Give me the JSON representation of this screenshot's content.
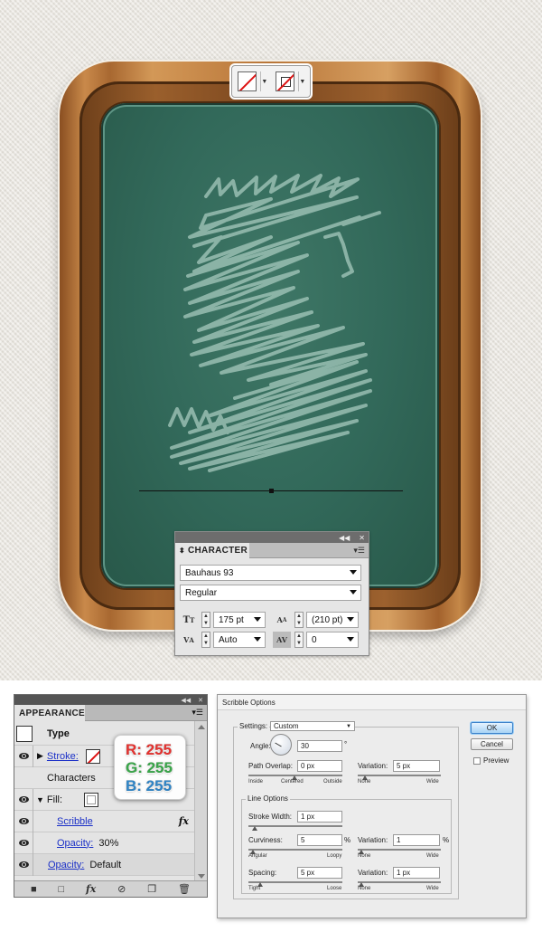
{
  "sf_widget": {
    "stroke_icon": "stroke-none-swatch",
    "fill_icon": "fill-none-swatch"
  },
  "character_panel": {
    "title": "CHARACTER",
    "font_family": "Bauhaus 93",
    "font_style": "Regular",
    "font_size": "175 pt",
    "leading": "(210 pt)",
    "kerning": "Auto",
    "tracking": "0"
  },
  "appearance_panel": {
    "title": "APPEARANCE",
    "type_label": "Type",
    "stroke_label": "Stroke:",
    "characters_label": "Characters",
    "fill_label": "Fill:",
    "scribble_label": "Scribble",
    "fx_label": "fx",
    "opacity_label": "Opacity:",
    "opacity_value": "30%",
    "opacity2_label": "Opacity:",
    "opacity2_value": "Default"
  },
  "rgb_callout": {
    "r_text": "R: 255",
    "g_text": "G: 255",
    "b_text": "B: 255",
    "r_color": "#e8322f",
    "g_color": "#3aa84a",
    "b_color": "#2f86c9"
  },
  "scribble_dialog": {
    "title": "Scribble Options",
    "settings_label": "Settings:",
    "settings_value": "Custom",
    "angle_label": "Angle:",
    "angle_value": "30",
    "angle_unit": "°",
    "path_overlap_label": "Path Overlap:",
    "path_overlap_value": "0 px",
    "overlap_caps": [
      "Inside",
      "Centered",
      "Outside"
    ],
    "overlap_variation_label": "Variation:",
    "overlap_variation_value": "5 px",
    "variation_caps": [
      "None",
      "Wide"
    ],
    "line_options_label": "Line Options",
    "stroke_width_label": "Stroke Width:",
    "stroke_width_value": "1 px",
    "curviness_label": "Curviness:",
    "curviness_value": "5",
    "curviness_unit": "%",
    "curviness_caps": [
      "Angular",
      "Loopy"
    ],
    "curviness_variation_label": "Variation:",
    "curviness_variation_value": "1",
    "curviness_variation_unit": "%",
    "spacing_label": "Spacing:",
    "spacing_value": "5 px",
    "spacing_caps": [
      "Tight",
      "Loose"
    ],
    "spacing_variation_label": "Variation:",
    "spacing_variation_value": "1 px",
    "ok_label": "OK",
    "cancel_label": "Cancel",
    "preview_label": "Preview",
    "preview_checked": false
  },
  "colors": {
    "board_green": "#32695a",
    "frame_wood": "#b87538",
    "scribble_stroke": "#a7c9bd",
    "link_blue": "#1a2fc7"
  }
}
